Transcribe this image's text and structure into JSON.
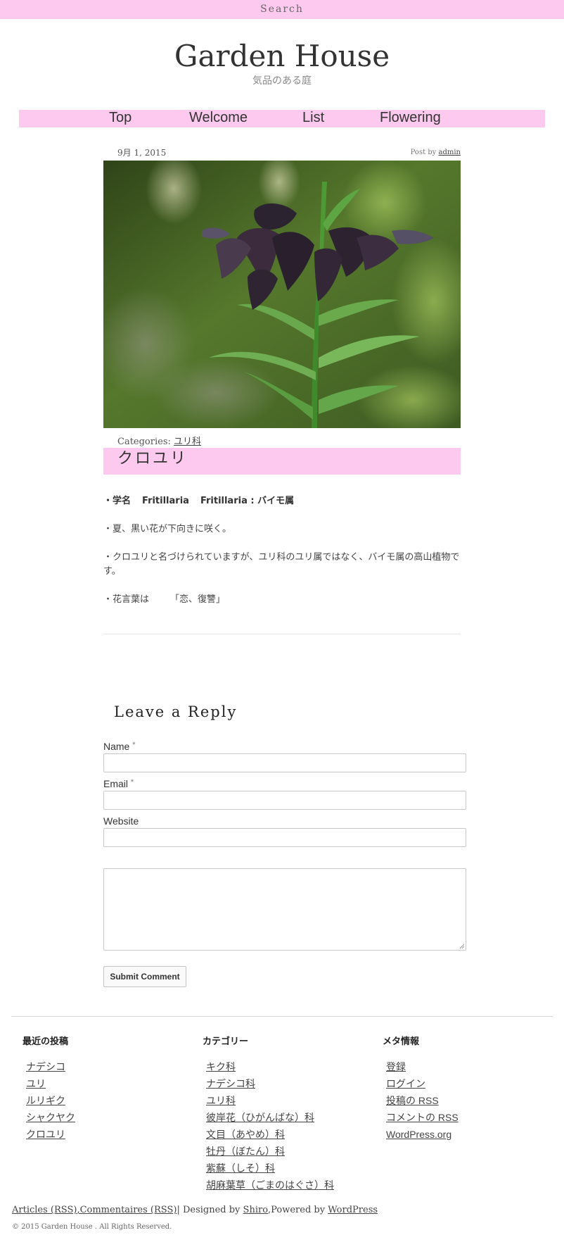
{
  "header": {
    "search_label": "Search",
    "site_title": "Garden House",
    "site_subtitle": "気品のある庭"
  },
  "nav": {
    "items": [
      {
        "label": "Top"
      },
      {
        "label": "Welcome"
      },
      {
        "label": "List"
      },
      {
        "label": "Flowering"
      }
    ]
  },
  "post": {
    "date": "9月 1, 2015",
    "post_by_label": "Post by",
    "author": "admin",
    "categories_label": "Categories:",
    "category": "ユリ科",
    "title": "クロユリ",
    "lines": {
      "sci_label": "・学名",
      "sci_name": "Fritillaria",
      "sci_genus": "Fritillaria : バイモ属",
      "line2": "・夏、黒い花が下向きに咲く。",
      "line3": "・クロユリと名づけられていますが、ユリ科のユリ属ではなく、バイモ属の高山植物です。",
      "line4_label": "・花言葉は",
      "line4_value": "「恋、復讐」"
    }
  },
  "reply": {
    "title": "Leave a Reply",
    "name_label": "Name",
    "email_label": "Email",
    "website_label": "Website",
    "required_mark": "*",
    "name_value": "",
    "email_value": "",
    "website_value": "",
    "comment_value": "",
    "submit_label": "Submit Comment"
  },
  "widgets": {
    "recent": {
      "title": "最近の投稿",
      "items": [
        {
          "label": "ナデシコ"
        },
        {
          "label": "ユリ"
        },
        {
          "label": "ルリギク"
        },
        {
          "label": "シャクヤク"
        },
        {
          "label": "クロユリ"
        }
      ]
    },
    "categories": {
      "title": "カテゴリー",
      "items": [
        {
          "label": "キク科"
        },
        {
          "label": "ナデシコ科"
        },
        {
          "label": "ユリ科"
        },
        {
          "label": "彼岸花（ひがんばな）科"
        },
        {
          "label": "文目（あやめ）科"
        },
        {
          "label": "牡丹（ぼたん）科"
        },
        {
          "label": "紫蘇（しそ）科"
        },
        {
          "label": "胡麻葉草（ごまのはぐさ）科"
        }
      ]
    },
    "meta": {
      "title": "メタ情報",
      "items": [
        {
          "label": "登録"
        },
        {
          "label": "ログイン"
        },
        {
          "label": "投稿の RSS"
        },
        {
          "label": "コメントの RSS"
        },
        {
          "label": "WordPress.org"
        }
      ]
    }
  },
  "footer": {
    "articles_rss": "Articles (RSS)",
    "comma": ",",
    "comments_rss": "Commentaires (RSS)",
    "designed_by": "| Designed by",
    "designer": "Shiro",
    "powered_by": ",Powered by",
    "platform": "WordPress",
    "copyright": "© 2015 Garden House . All Rights Reserved."
  },
  "colors": {
    "accent_pink": "#fdc9ee"
  }
}
